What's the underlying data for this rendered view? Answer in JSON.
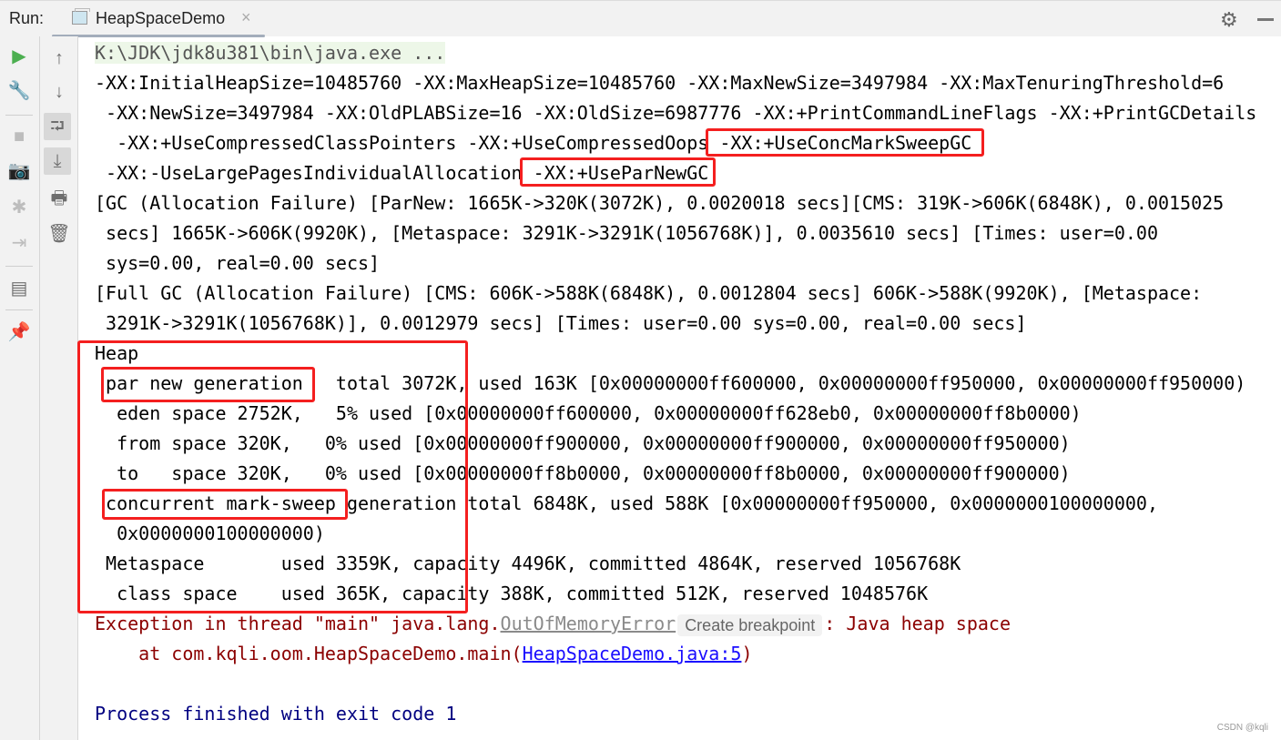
{
  "toolbar": {
    "run_label": "Run:",
    "tab_title": "HeapSpaceDemo",
    "tab_close": "×",
    "gear": "⚙"
  },
  "left_tools": [
    {
      "name": "rerun-icon",
      "glyph": "▶",
      "color": "#4caf50"
    },
    {
      "name": "wrench-icon",
      "glyph": "🔧"
    },
    {
      "name": "stop-icon",
      "glyph": "■",
      "disabled": true
    },
    {
      "name": "camera-icon",
      "glyph": "📷",
      "disabled": true
    },
    {
      "name": "debug-icon",
      "glyph": "✱",
      "disabled": true
    },
    {
      "name": "login-icon",
      "glyph": "⇥",
      "disabled": true
    },
    {
      "name": "layout-icon",
      "glyph": "▤"
    },
    {
      "name": "pin-icon",
      "glyph": "📌"
    }
  ],
  "right_tools": [
    {
      "name": "up-arrow-icon",
      "glyph": "↑"
    },
    {
      "name": "down-arrow-icon",
      "glyph": "↓"
    },
    {
      "name": "soft-wrap-icon",
      "glyph": "⮒"
    },
    {
      "name": "scroll-to-end-icon",
      "glyph": "⤓"
    },
    {
      "name": "print-icon",
      "glyph": "🖶"
    },
    {
      "name": "trash-icon",
      "glyph": "🗑"
    }
  ],
  "console": {
    "lines": [
      [
        {
          "t": "K:\\JDK\\jdk8u381\\bin\\java.exe ...",
          "c": "cmd"
        }
      ],
      [
        {
          "t": "-XX:InitialHeapSize=10485760 -XX:MaxHeapSize=10485760 -XX:MaxNewSize=3497984 -XX:MaxTenuringThreshold=6"
        }
      ],
      [
        {
          "t": " -XX:NewSize=3497984 -XX:OldPLABSize=16 -XX:OldSize=6987776 -XX:+PrintCommandLineFlags -XX:+PrintGCDetails"
        }
      ],
      [
        {
          "t": "  -XX:+UseCompressedClassPointers -XX:+UseCompressedOops -XX:+UseConcMarkSweepGC"
        }
      ],
      [
        {
          "t": " -XX:-UseLargePagesIndividualAllocation -XX:+UseParNewGC"
        }
      ],
      [
        {
          "t": "[GC (Allocation Failure) [ParNew: 1665K->320K(3072K), 0.0020018 secs][CMS: 319K->606K(6848K), 0.0015025"
        }
      ],
      [
        {
          "t": " secs] 1665K->606K(9920K), [Metaspace: 3291K->3291K(1056768K)], 0.0035610 secs] [Times: user=0.00"
        }
      ],
      [
        {
          "t": " sys=0.00, real=0.00 secs]"
        }
      ],
      [
        {
          "t": "[Full GC (Allocation Failure) [CMS: 606K->588K(6848K), 0.0012804 secs] 606K->588K(9920K), [Metaspace:"
        }
      ],
      [
        {
          "t": " 3291K->3291K(1056768K)], 0.0012979 secs] [Times: user=0.00 sys=0.00, real=0.00 secs]"
        }
      ],
      [
        {
          "t": "Heap"
        }
      ],
      [
        {
          "t": " par new generation   total 3072K, used 163K [0x00000000ff600000, 0x00000000ff950000, 0x00000000ff950000)"
        }
      ],
      [
        {
          "t": "  eden space 2752K,   5% used [0x00000000ff600000, 0x00000000ff628eb0, 0x00000000ff8b0000)"
        }
      ],
      [
        {
          "t": "  from space 320K,   0% used [0x00000000ff900000, 0x00000000ff900000, 0x00000000ff950000)"
        }
      ],
      [
        {
          "t": "  to   space 320K,   0% used [0x00000000ff8b0000, 0x00000000ff8b0000, 0x00000000ff900000)"
        }
      ],
      [
        {
          "t": " concurrent mark-sweep generation total 6848K, used 588K [0x00000000ff950000, 0x0000000100000000,"
        }
      ],
      [
        {
          "t": "  0x0000000100000000)"
        }
      ],
      [
        {
          "t": " Metaspace       used 3359K, capacity 4496K, committed 4864K, reserved 1056768K"
        }
      ],
      [
        {
          "t": "  class space    used 365K, capacity 388K, committed 512K, reserved 1048576K"
        }
      ],
      [
        {
          "t": "Exception in thread \"main\" java.lang.",
          "c": "err"
        },
        {
          "t": "OutOfMemoryError",
          "c": "exc-class"
        },
        {
          "t": "Create breakpoint",
          "c": "tooltip"
        },
        {
          "t": ": Java heap space",
          "c": "err"
        }
      ],
      [
        {
          "t": "    at com.kqli.oom.HeapSpaceDemo.main(",
          "c": "err"
        },
        {
          "t": "HeapSpaceDemo.java:5",
          "c": "link"
        },
        {
          "t": ")",
          "c": "err"
        }
      ],
      [
        {
          "t": ""
        }
      ],
      [
        {
          "t": "Process finished with exit code 1",
          "c": "info"
        }
      ]
    ]
  },
  "colors": {
    "highlight_box": "#f41f1f",
    "error_text": "#8b0000",
    "exit_text": "#000080",
    "link": "#1a0dff"
  },
  "watermark": "CSDN @kqli"
}
